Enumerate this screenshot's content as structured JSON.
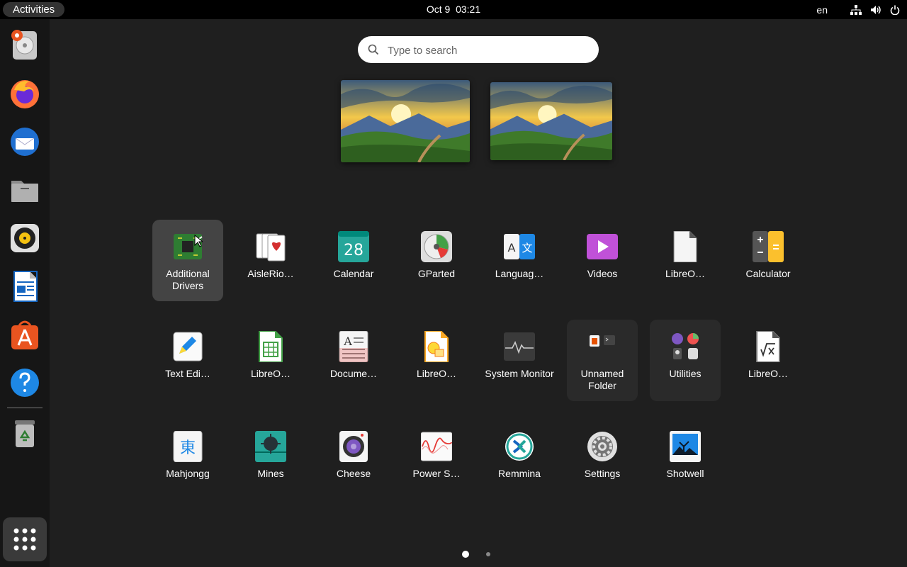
{
  "topbar": {
    "activities": "Activities",
    "date": "Oct 9",
    "time": "03:21",
    "lang": "en"
  },
  "search": {
    "placeholder": "Type to search"
  },
  "dock": {
    "items": [
      "Disks",
      "Firefox",
      "Thunderbird",
      "Files",
      "Rhythmbox",
      "LibreOffice Writer",
      "Ubuntu Software",
      "Help",
      "Trash"
    ],
    "show_apps": "Show Applications"
  },
  "apps": {
    "row1": [
      "Additional Drivers",
      "AisleRio…",
      "Calendar",
      "GParted",
      "Languag…",
      "Videos",
      "LibreO…",
      "Calculator"
    ],
    "row2": [
      "Text Edi…",
      "LibreO…",
      "Docume…",
      "LibreO…",
      "System Monitor",
      "Unnamed Folder",
      "Utilities",
      "LibreO…"
    ],
    "row3": [
      "Mahjongg",
      "Mines",
      "Cheese",
      "Power S…",
      "Remmina",
      "Settings",
      "Shotwell"
    ]
  },
  "calendar_day": "28",
  "pages": {
    "current": 1,
    "total": 2
  },
  "colors": {
    "background": "#1f1f1f",
    "topbar": "#000000",
    "dock": "#161616",
    "accent": "#e95420"
  }
}
